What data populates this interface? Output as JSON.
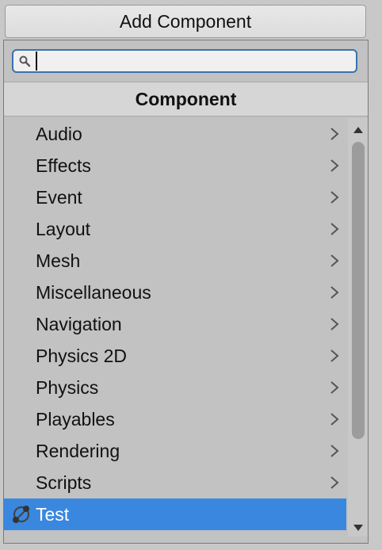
{
  "add_component_button": {
    "label": "Add Component"
  },
  "search": {
    "value": "",
    "placeholder": ""
  },
  "section": {
    "title": "Component"
  },
  "items": [
    {
      "label": "Audio",
      "icon": "chevron-right-icon"
    },
    {
      "label": "Effects",
      "icon": "chevron-right-icon"
    },
    {
      "label": "Event",
      "icon": "chevron-right-icon"
    },
    {
      "label": "Layout",
      "icon": "chevron-right-icon"
    },
    {
      "label": "Mesh",
      "icon": "chevron-right-icon"
    },
    {
      "label": "Miscellaneous",
      "icon": "chevron-right-icon"
    },
    {
      "label": "Navigation",
      "icon": "chevron-right-icon"
    },
    {
      "label": "Physics 2D",
      "icon": "chevron-right-icon"
    },
    {
      "label": "Physics",
      "icon": "chevron-right-icon"
    },
    {
      "label": "Playables",
      "icon": "chevron-right-icon"
    },
    {
      "label": "Rendering",
      "icon": "chevron-right-icon"
    },
    {
      "label": "Scripts",
      "icon": "chevron-right-icon"
    },
    {
      "label": "Test",
      "icon": "script-icon",
      "selected": true
    }
  ],
  "colors": {
    "selection": "#3a87e0",
    "search_border": "#3a72b0",
    "background": "#c2c2c2"
  }
}
